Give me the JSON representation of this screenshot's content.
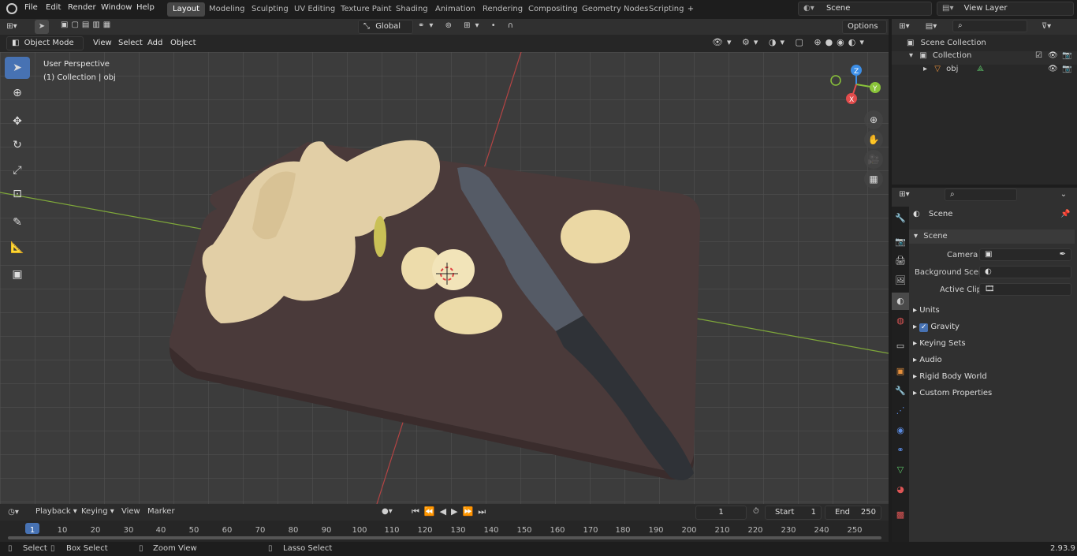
{
  "topbar": {
    "menus": [
      "File",
      "Edit",
      "Render",
      "Window",
      "Help"
    ],
    "workspaces": [
      "Layout",
      "Modeling",
      "Sculpting",
      "UV Editing",
      "Texture Paint",
      "Shading",
      "Animation",
      "Rendering",
      "Compositing",
      "Geometry Nodes",
      "Scripting"
    ],
    "active_workspace": "Layout",
    "scene": "Scene",
    "view_layer": "View Layer"
  },
  "viewport_header": {
    "mode": "Object Mode",
    "menus": [
      "View",
      "Select",
      "Add",
      "Object"
    ],
    "orientation": "Global",
    "options": "Options"
  },
  "viewport": {
    "perspective": "User Perspective",
    "collection": "(1) Collection | obj",
    "gizmo": {
      "x": "X",
      "y": "Y",
      "z": "Z"
    }
  },
  "outliner": {
    "search_placeholder": "",
    "items": [
      "Scene Collection",
      "Collection",
      "obj"
    ]
  },
  "properties": {
    "header": "Scene",
    "panel": "Scene",
    "fields": [
      {
        "label": "Camera",
        "value": ""
      },
      {
        "label": "Background Scene",
        "value": ""
      },
      {
        "label": "Active Clip",
        "value": ""
      }
    ],
    "subpanels": [
      "Units",
      "Gravity",
      "Keying Sets",
      "Audio",
      "Rigid Body World",
      "Custom Properties"
    ]
  },
  "timeline": {
    "menus": [
      "Playback",
      "Keying",
      "View",
      "Marker"
    ],
    "current_frame": "1",
    "start_label": "Start",
    "start": "1",
    "end_label": "End",
    "end": "250",
    "ticks": [
      "1",
      "10",
      "20",
      "30",
      "40",
      "50",
      "60",
      "70",
      "80",
      "90",
      "100",
      "110",
      "120",
      "130",
      "140",
      "150",
      "160",
      "170",
      "180",
      "190",
      "200",
      "210",
      "220",
      "230",
      "240",
      "250"
    ]
  },
  "status": {
    "items": [
      "Select",
      "Box Select",
      "Zoom View",
      "Lasso Select"
    ],
    "version": "2.93.9"
  },
  "colors": {
    "accent": "#4772b3",
    "x_axis": "#e24c4c",
    "y_axis": "#8ac43a",
    "z_axis": "#3c8ee6"
  }
}
